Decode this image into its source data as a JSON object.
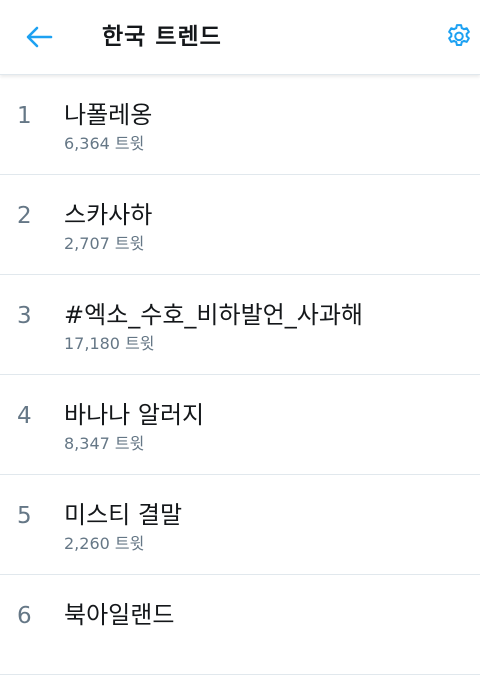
{
  "header": {
    "title": "한국 트렌드",
    "back_icon": "arrow-left-icon",
    "settings_icon": "gear-icon",
    "accent_color": "#1da1f2"
  },
  "trends": [
    {
      "rank": "1",
      "name": "나폴레옹",
      "count": "6,364 트윗"
    },
    {
      "rank": "2",
      "name": "스카사하",
      "count": "2,707 트윗"
    },
    {
      "rank": "3",
      "name": "#엑소_수호_비하발언_사과해",
      "count": "17,180 트윗"
    },
    {
      "rank": "4",
      "name": "바나나 알러지",
      "count": "8,347 트윗"
    },
    {
      "rank": "5",
      "name": "미스티 결말",
      "count": "2,260 트윗"
    },
    {
      "rank": "6",
      "name": "북아일랜드",
      "count": ""
    }
  ]
}
